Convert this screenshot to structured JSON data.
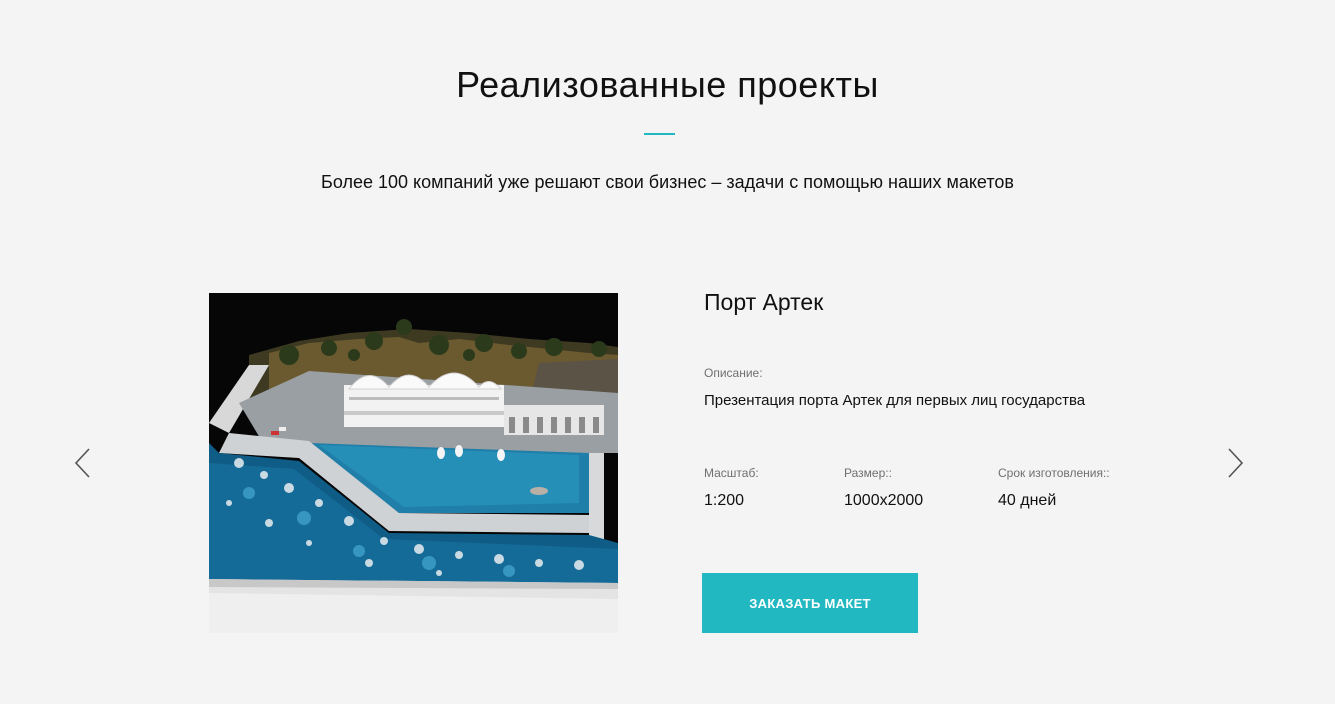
{
  "section": {
    "title": "Реализованные проекты",
    "subtitle": "Более 100 компаний уже решают свои бизнес – задачи с помощью наших макетов",
    "accent_color": "#22b8c2"
  },
  "slider": {
    "prev_icon": "chevron-left-icon",
    "next_icon": "chevron-right-icon"
  },
  "project": {
    "name": "Порт Артек",
    "image": "photo of architectural scale model of a seaport",
    "description_label": "Описание:",
    "description": "Презентация порта Артек для первых лиц государства",
    "scale_label": "Масштаб:",
    "scale": "1:200",
    "size_label": "Размер::",
    "size": "1000х2000",
    "term_label": "Срок изготовления::",
    "term": "40 дней",
    "order_button": "ЗАКАЗАТЬ МАКЕТ"
  }
}
